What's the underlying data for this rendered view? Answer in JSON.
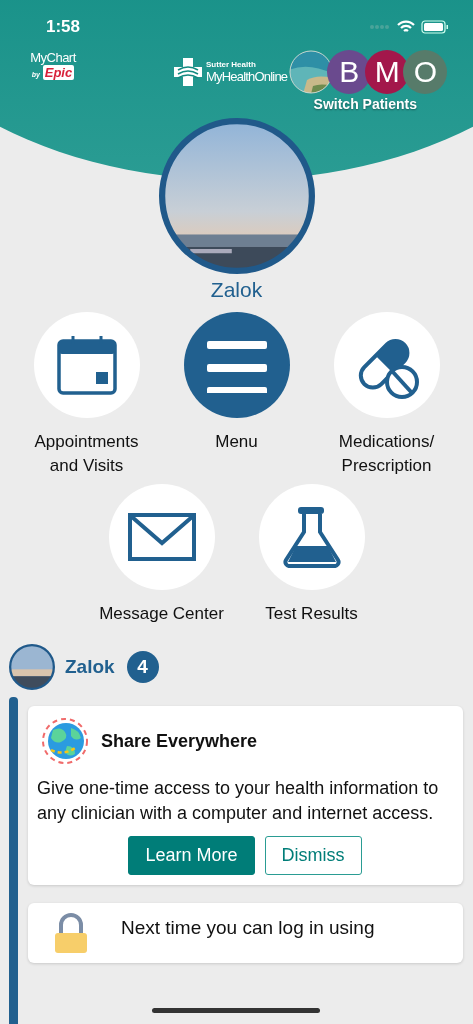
{
  "status_bar": {
    "time": "1:58"
  },
  "header": {
    "app_logo": {
      "name": "MyChart",
      "by": "by",
      "brand": "Epic"
    },
    "org_logo": {
      "org": "Sutter Health",
      "product": "MyHealthOnline"
    },
    "patients": [
      {
        "kind": "picture"
      },
      {
        "kind": "initial",
        "initial": "B",
        "color": "#6a4a8e"
      },
      {
        "kind": "initial",
        "initial": "M",
        "color": "#a3174b"
      },
      {
        "kind": "initial",
        "initial": "O",
        "color": "#577b6a"
      }
    ],
    "switch_label": "Switch Patients"
  },
  "profile": {
    "name": "Zalok"
  },
  "shortcuts": [
    {
      "kind": "calendar",
      "label": "Appointments and Visits",
      "highlighted": false
    },
    {
      "kind": "menu",
      "label": "Menu",
      "highlighted": true
    },
    {
      "kind": "pills",
      "label": "Medications/ Prescription",
      "highlighted": false
    },
    {
      "kind": "envelope",
      "label": "Message Center",
      "highlighted": false
    },
    {
      "kind": "flask",
      "label": "Test Results",
      "highlighted": false
    }
  ],
  "feed": {
    "name": "Zalok",
    "count": "4",
    "cards": [
      {
        "kind": "promo",
        "title": "Share Everywhere",
        "body": "Give one-time access to your health information to any clinician with a computer and internet access.",
        "buttons": [
          {
            "label": "Learn More",
            "primary": true
          },
          {
            "label": "Dismiss",
            "primary": false
          }
        ]
      },
      {
        "kind": "lock",
        "body": "Next time you can log in using"
      }
    ]
  }
}
